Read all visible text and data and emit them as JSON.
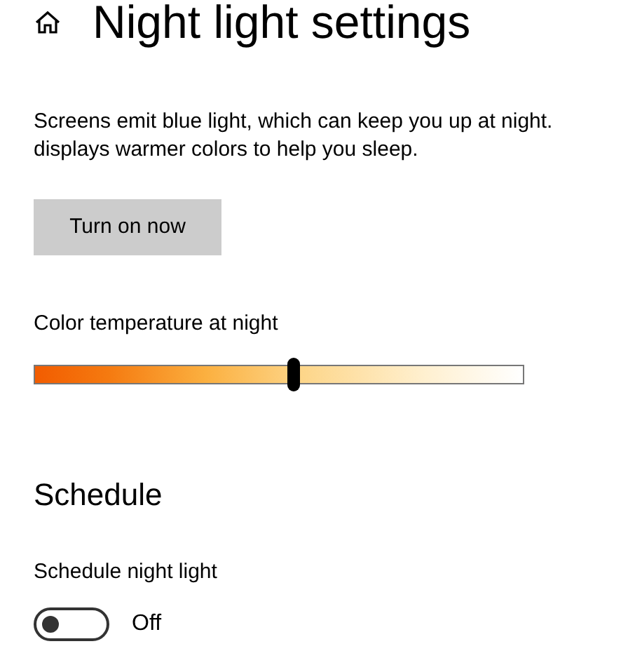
{
  "header": {
    "title": "Night light settings"
  },
  "description": "Screens emit blue light, which can keep you up at night.\ndisplays warmer colors to help you sleep.",
  "turn_on_button": "Turn on now",
  "color_temperature": {
    "label": "Color temperature at night",
    "level": 0.53
  },
  "schedule": {
    "heading": "Schedule",
    "toggle_label": "Schedule night light",
    "on": false,
    "state_text": "Off"
  }
}
